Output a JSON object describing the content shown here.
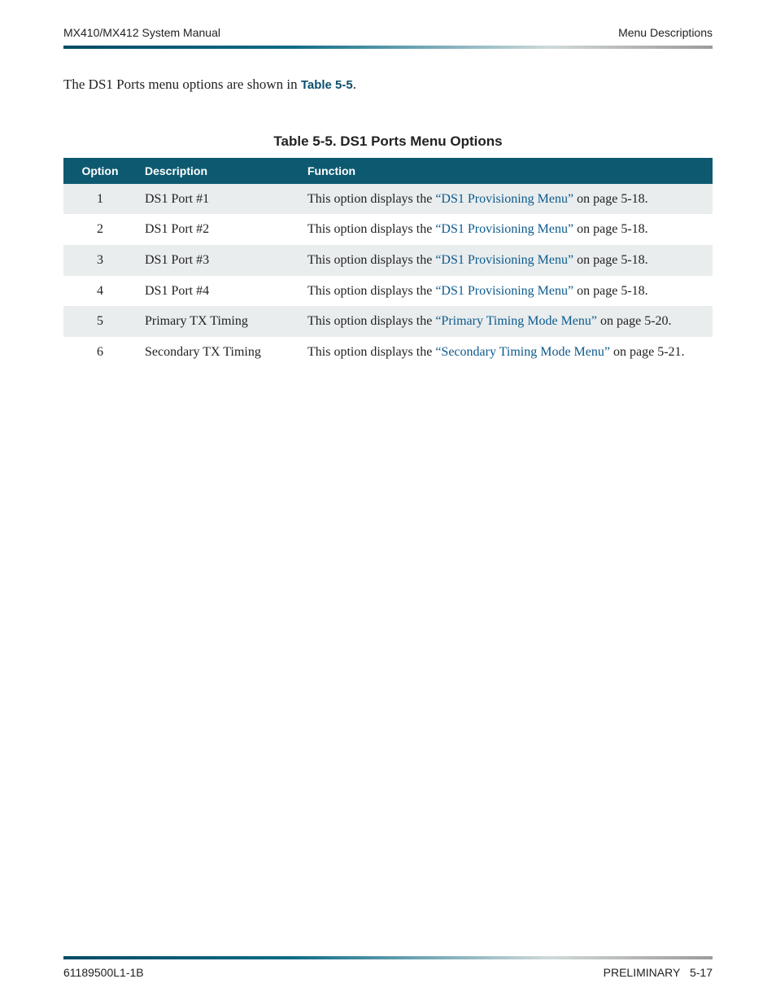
{
  "header": {
    "left": "MX410/MX412 System Manual",
    "right": "Menu Descriptions"
  },
  "intro": {
    "prefix": "The DS1 Ports menu options are shown in ",
    "link": "Table 5-5",
    "suffix": "."
  },
  "table": {
    "caption": "Table 5-5.  DS1 Ports Menu Options",
    "columns": {
      "option": "Option",
      "description": "Description",
      "function": "Function"
    },
    "rows": [
      {
        "option": "1",
        "description": "DS1 Port #1",
        "function_before": "This option displays the ",
        "function_link": "“DS1 Provisioning Menu”",
        "function_after": " on page 5-18."
      },
      {
        "option": "2",
        "description": "DS1 Port #2",
        "function_before": "This option displays the ",
        "function_link": "“DS1 Provisioning Menu”",
        "function_after": " on page 5-18."
      },
      {
        "option": "3",
        "description": "DS1 Port #3",
        "function_before": "This option displays the ",
        "function_link": "“DS1 Provisioning Menu”",
        "function_after": " on page 5-18."
      },
      {
        "option": "4",
        "description": "DS1 Port #4",
        "function_before": "This option displays the ",
        "function_link": "“DS1 Provisioning Menu”",
        "function_after": " on page 5-18."
      },
      {
        "option": "5",
        "description": "Primary TX Timing",
        "function_before": "This option displays the ",
        "function_link": "“Primary Timing Mode Menu”",
        "function_after": " on page 5-20."
      },
      {
        "option": "6",
        "description": "Secondary TX Timing",
        "function_before": "This option displays the ",
        "function_link": "“Secondary Timing Mode Menu”",
        "function_after": " on page 5-21."
      }
    ]
  },
  "footer": {
    "left": "61189500L1-1B",
    "right_label": "PRELIMINARY",
    "right_page": "5-17"
  }
}
